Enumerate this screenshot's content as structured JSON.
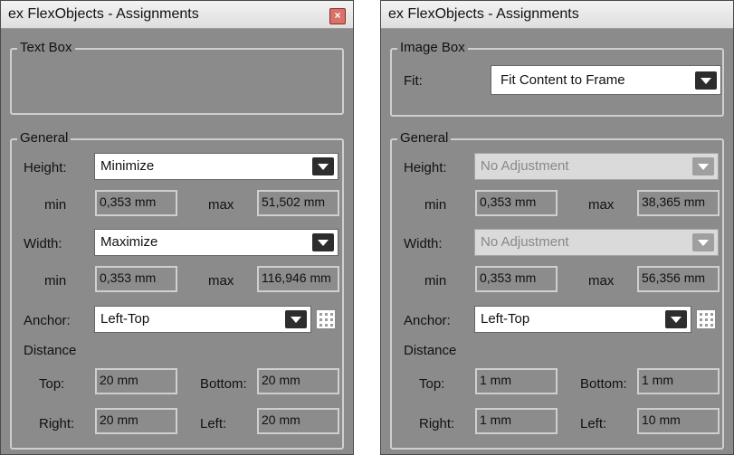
{
  "left": {
    "title": "ex FlexObjects - Assignments",
    "top_group": {
      "label": "Text Box"
    },
    "general": {
      "label": "General",
      "height_label": "Height:",
      "height_value": "Minimize",
      "height_min_label": "min",
      "height_min": "0,353 mm",
      "height_max_label": "max",
      "height_max": "51,502 mm",
      "width_label": "Width:",
      "width_value": "Maximize",
      "width_min_label": "min",
      "width_min": "0,353 mm",
      "width_max_label": "max",
      "width_max": "116,946 mm",
      "anchor_label": "Anchor:",
      "anchor_value": "Left-Top",
      "distance_label": "Distance",
      "top_label": "Top:",
      "top_value": "20 mm",
      "bottom_label": "Bottom:",
      "bottom_value": "20 mm",
      "right_label": "Right:",
      "right_value": "20 mm",
      "left_label": "Left:",
      "left_value": "20 mm"
    }
  },
  "right": {
    "title": "ex FlexObjects - Assignments",
    "top_group": {
      "label": "Image Box",
      "fit_label": "Fit:",
      "fit_value": "Fit Content to Frame"
    },
    "general": {
      "label": "General",
      "height_label": "Height:",
      "height_value": "No Adjustment",
      "height_min_label": "min",
      "height_min": "0,353 mm",
      "height_max_label": "max",
      "height_max": "38,365 mm",
      "width_label": "Width:",
      "width_value": "No Adjustment",
      "width_min_label": "min",
      "width_min": "0,353 mm",
      "width_max_label": "max",
      "width_max": "56,356 mm",
      "anchor_label": "Anchor:",
      "anchor_value": "Left-Top",
      "distance_label": "Distance",
      "top_label": "Top:",
      "top_value": "1 mm",
      "bottom_label": "Bottom:",
      "bottom_value": "1 mm",
      "right_label": "Right:",
      "right_value": "1 mm",
      "left_label": "Left:",
      "left_value": "10 mm"
    }
  },
  "colors": {
    "panel_bg": "#8b8b8b",
    "close_button": "#d9726b",
    "dropdown_arrow": "#2d2d2d"
  },
  "icons": {
    "close": "close-icon",
    "dropdown": "chevron-down-icon",
    "anchor_picker": "anchor-grid-icon"
  }
}
